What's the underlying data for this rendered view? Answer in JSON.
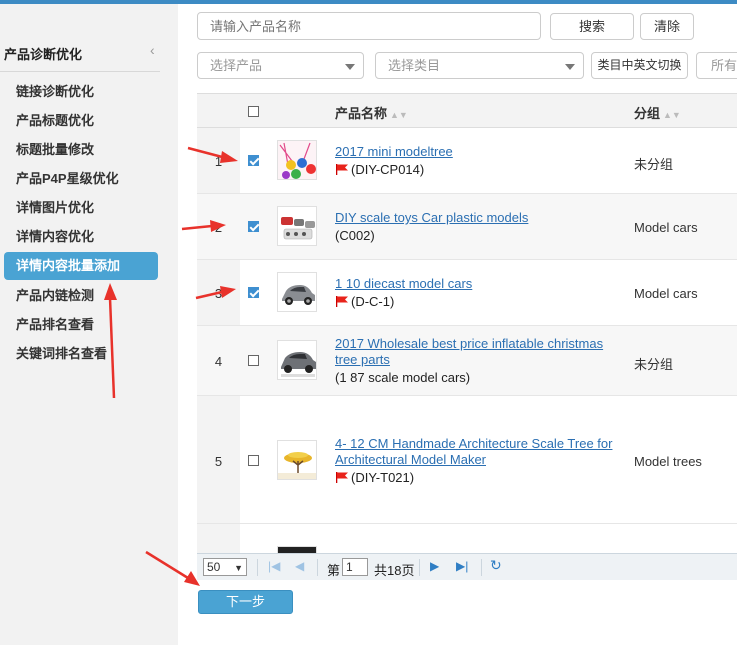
{
  "sidebar": {
    "header": "产品诊断优化",
    "collapse_icon": "chevron-left-icon",
    "items": [
      {
        "label": "链接诊断优化",
        "active": false
      },
      {
        "label": "产品标题优化",
        "active": false
      },
      {
        "label": "标题批量修改",
        "active": false
      },
      {
        "label": "产品P4P星级优化",
        "active": false
      },
      {
        "label": "详情图片优化",
        "active": false
      },
      {
        "label": "详情内容优化",
        "active": false
      },
      {
        "label": "详情内容批量添加",
        "active": true
      },
      {
        "label": "产品内链检测",
        "active": false
      },
      {
        "label": "产品排名查看",
        "active": false
      },
      {
        "label": "关键词排名查看",
        "active": false
      }
    ]
  },
  "filters": {
    "search_placeholder": "请输入产品名称",
    "search_button": "搜索",
    "clear_button": "清除",
    "product_select": "选择产品",
    "category_select": "选择类目",
    "lang_toggle": "类目中英文切换",
    "all_select": "所有"
  },
  "table": {
    "columns": [
      "产品名称",
      "分组"
    ],
    "rows": [
      {
        "num": "1",
        "checked": true,
        "name": "2017 mini modeltree",
        "code": "(DIY-CP014)",
        "flag": true,
        "group": "未分组",
        "thumb": "paint-pots-thumb"
      },
      {
        "num": "2",
        "checked": true,
        "name": "DIY scale toys Car plastic models",
        "code": "(C002)",
        "flag": false,
        "group": "Model cars",
        "thumb": "toy-cars-thumb"
      },
      {
        "num": "3",
        "checked": true,
        "name": "1 10 diecast model cars",
        "code": "(D-C-1)",
        "flag": true,
        "group": "Model cars",
        "thumb": "silver-car-thumb"
      },
      {
        "num": "4",
        "checked": false,
        "name": "2017 Wholesale best price inflatable christmas tree parts",
        "code": "(1 87 scale model cars)",
        "flag": false,
        "group": "未分组",
        "thumb": "grey-car-thumb"
      },
      {
        "num": "5",
        "checked": false,
        "name": "4- 12 CM Handmade Architecture Scale Tree for Architectural Model Maker",
        "code": "(DIY-T021)",
        "flag": true,
        "group": "Model trees",
        "thumb": "yellow-tree-thumb"
      }
    ]
  },
  "pager": {
    "page_size": "50",
    "page_prefix": "第",
    "current_page": "1",
    "total_text": "共18页"
  },
  "next_button": "下一步",
  "colors": {
    "accent": "#4aa3d3",
    "link": "#2b6fb2",
    "annotation_arrow": "#e8322b"
  }
}
